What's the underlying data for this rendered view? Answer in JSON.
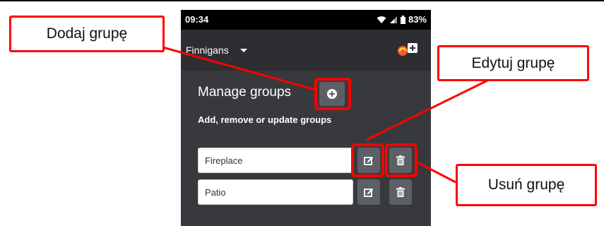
{
  "status_bar": {
    "time": "09:34",
    "battery": "83%"
  },
  "app_bar": {
    "account": "Finnigans"
  },
  "page": {
    "title": "Manage groups",
    "subtitle": "Add, remove or update groups"
  },
  "groups": [
    {
      "name": "Fireplace"
    },
    {
      "name": "Patio"
    }
  ],
  "callouts": {
    "add": "Dodaj grupę",
    "edit": "Edytuj grupę",
    "delete": "Usuń grupę"
  },
  "colors": {
    "highlight": "#ff0000",
    "background": "#37393d",
    "appbar": "#2c2e31",
    "button": "#5c6066"
  }
}
